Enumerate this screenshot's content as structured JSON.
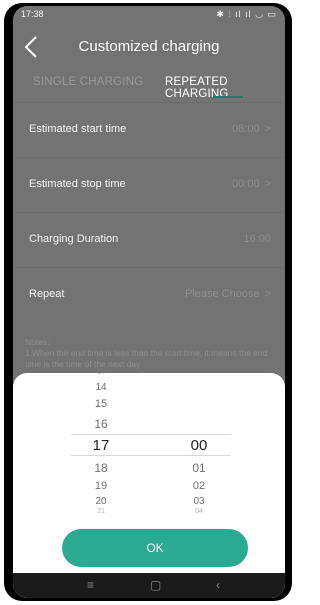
{
  "status_bar": {
    "time": "17:38",
    "alarm_icon": "alarm-icon",
    "right_icons": "✱ ⫶ ıl ıl ◡ ▭"
  },
  "header": {
    "title": "Customized charging",
    "back_icon": "back-chevron-icon"
  },
  "tabs": [
    {
      "label": "SINGLE CHARGING",
      "active": false
    },
    {
      "label": "REPEATED CHARGING",
      "active": true
    }
  ],
  "rows": [
    {
      "label": "Estimated start time",
      "value": "08:00",
      "chevron": ">"
    },
    {
      "label": "Estimated stop time",
      "value": "00:00",
      "chevron": ">"
    },
    {
      "label": "Charging Duration",
      "value": "16:00",
      "chevron": ""
    },
    {
      "label": "Repeat",
      "value": "Please Choose",
      "chevron": ">"
    }
  ],
  "notes": {
    "title": "Notes:",
    "text": "1.When the end time is less than the start time, it means the end time is the time of the next day"
  },
  "picker": {
    "hours": [
      "14",
      "15",
      "16",
      "17",
      "18",
      "19",
      "20",
      "21"
    ],
    "minutes": [
      "00",
      "01",
      "02",
      "03",
      "04"
    ],
    "selected_hour": "17",
    "selected_minute": "00"
  },
  "ok_button": {
    "label": "OK"
  },
  "nav_bar": {
    "menu": "≡",
    "home": "▢",
    "back": "‹"
  },
  "colors": {
    "accent": "#2aaa92",
    "tab_indicator": "#1b7a6a"
  }
}
